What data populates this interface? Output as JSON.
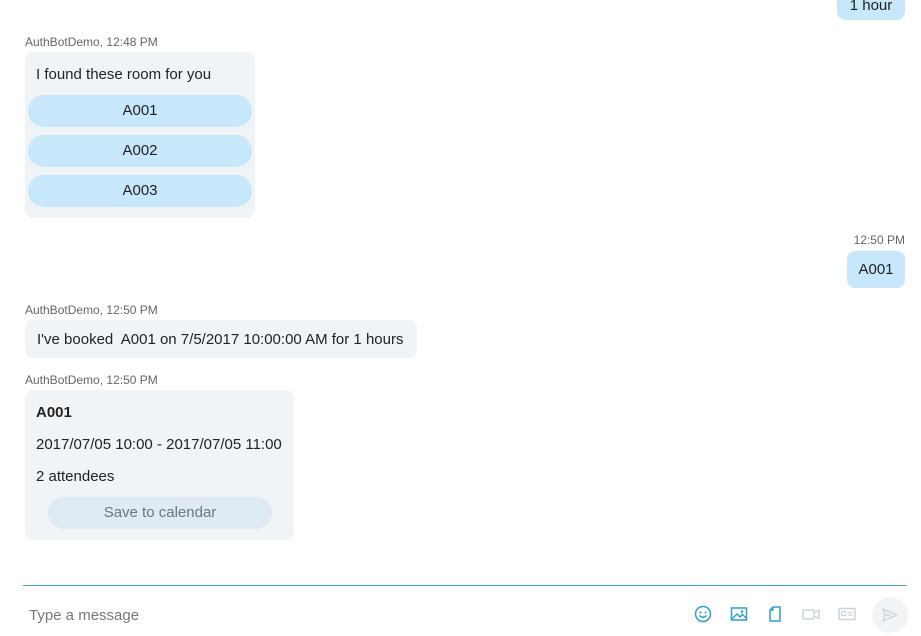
{
  "messages": {
    "user_1": {
      "text": "1 hour"
    },
    "bot_rooms": {
      "sender": "AuthBotDemo",
      "time": "12:48 PM",
      "text": "I found these room for you",
      "rooms": [
        "A001",
        "A002",
        "A003"
      ]
    },
    "user_2": {
      "time": "12:50 PM",
      "text": "A001"
    },
    "bot_booked": {
      "sender": "AuthBotDemo",
      "time": "12:50 PM",
      "text": "I've booked  A001 on 7/5/2017 10:00:00 AM for 1 hours"
    },
    "bot_card": {
      "sender": "AuthBotDemo",
      "time": "12:50 PM",
      "title": "A001",
      "time_range": "2017/07/05 10:00 - 2017/07/05 11:00",
      "attendees": "2 attendees",
      "button_label": "Save to calendar"
    }
  },
  "composer": {
    "placeholder": "Type a message",
    "icons": [
      "emoji-icon",
      "image-icon",
      "file-icon",
      "video-icon",
      "card-icon",
      "send-icon"
    ]
  },
  "colors": {
    "accent": "#3aa6cc",
    "user_bubble": "#c7e7fb",
    "bot_bubble": "#f1f4f7",
    "enabled_icon": "#2b9fd1",
    "disabled_icon": "#c9d6de"
  }
}
